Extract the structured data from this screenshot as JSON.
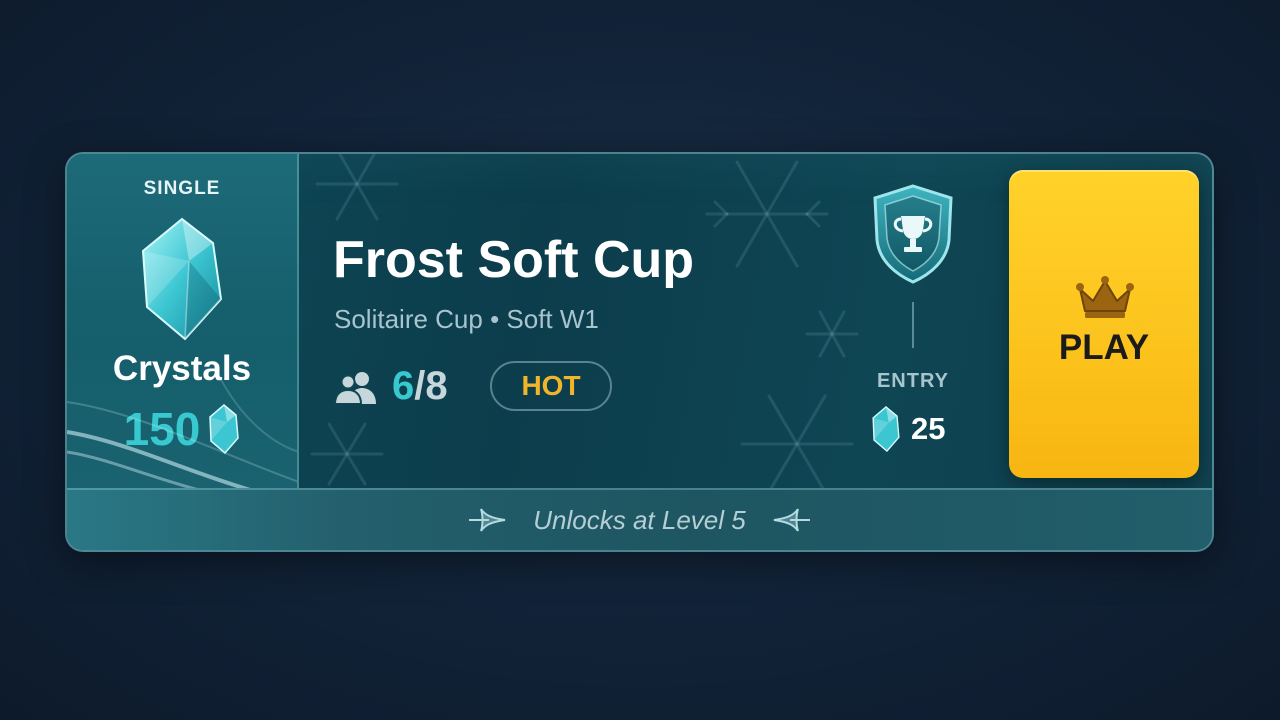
{
  "card": {
    "reward": {
      "tag": "SINGLE",
      "name": "Crystals",
      "amount": "150",
      "icon": "crystal-icon"
    },
    "title": "Frost Soft Cup",
    "subtitle": "Solitaire Cup • Soft W1",
    "players": {
      "icon": "people-icon",
      "current": "6",
      "max": "/8"
    },
    "badge": "HOT",
    "entry": {
      "icon": "trophy-shield-icon",
      "label": "ENTRY",
      "cost": "25",
      "cost_icon": "crystal-icon"
    },
    "play_button": {
      "icon": "crown-icon",
      "label": "PLAY"
    },
    "footer": {
      "text": "Unlocks at Level 5"
    }
  },
  "colors": {
    "accent_cyan": "#37c9cf",
    "badge_gold": "#f2b52a",
    "play_yellow": "#fcc21c",
    "card_teal": "#0f4a58"
  }
}
